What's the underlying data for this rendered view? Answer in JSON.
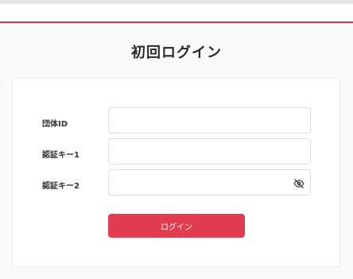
{
  "page": {
    "title": "初回ログイン"
  },
  "form": {
    "fields": [
      {
        "label": "団体ID",
        "value": "",
        "placeholder": ""
      },
      {
        "label": "認証キー1",
        "value": "",
        "placeholder": ""
      },
      {
        "label": "認証キー2",
        "value": "",
        "placeholder": "",
        "toggle_icon": "eye-off-icon"
      }
    ],
    "submit_label": "ログイン"
  },
  "colors": {
    "accent": "#e23c50",
    "header_rule": "#d9363e"
  }
}
